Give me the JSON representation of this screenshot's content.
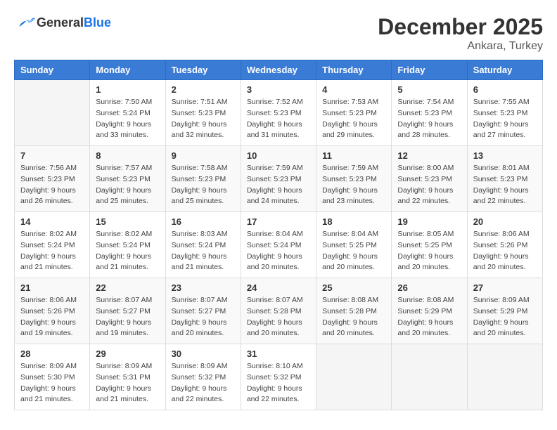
{
  "logo": {
    "general": "General",
    "blue": "Blue"
  },
  "header": {
    "month": "December 2025",
    "location": "Ankara, Turkey"
  },
  "weekdays": [
    "Sunday",
    "Monday",
    "Tuesday",
    "Wednesday",
    "Thursday",
    "Friday",
    "Saturday"
  ],
  "weeks": [
    [
      {
        "day": "",
        "info": ""
      },
      {
        "day": "1",
        "info": "Sunrise: 7:50 AM\nSunset: 5:24 PM\nDaylight: 9 hours\nand 33 minutes."
      },
      {
        "day": "2",
        "info": "Sunrise: 7:51 AM\nSunset: 5:23 PM\nDaylight: 9 hours\nand 32 minutes."
      },
      {
        "day": "3",
        "info": "Sunrise: 7:52 AM\nSunset: 5:23 PM\nDaylight: 9 hours\nand 31 minutes."
      },
      {
        "day": "4",
        "info": "Sunrise: 7:53 AM\nSunset: 5:23 PM\nDaylight: 9 hours\nand 29 minutes."
      },
      {
        "day": "5",
        "info": "Sunrise: 7:54 AM\nSunset: 5:23 PM\nDaylight: 9 hours\nand 28 minutes."
      },
      {
        "day": "6",
        "info": "Sunrise: 7:55 AM\nSunset: 5:23 PM\nDaylight: 9 hours\nand 27 minutes."
      }
    ],
    [
      {
        "day": "7",
        "info": "Sunrise: 7:56 AM\nSunset: 5:23 PM\nDaylight: 9 hours\nand 26 minutes."
      },
      {
        "day": "8",
        "info": "Sunrise: 7:57 AM\nSunset: 5:23 PM\nDaylight: 9 hours\nand 25 minutes."
      },
      {
        "day": "9",
        "info": "Sunrise: 7:58 AM\nSunset: 5:23 PM\nDaylight: 9 hours\nand 25 minutes."
      },
      {
        "day": "10",
        "info": "Sunrise: 7:59 AM\nSunset: 5:23 PM\nDaylight: 9 hours\nand 24 minutes."
      },
      {
        "day": "11",
        "info": "Sunrise: 7:59 AM\nSunset: 5:23 PM\nDaylight: 9 hours\nand 23 minutes."
      },
      {
        "day": "12",
        "info": "Sunrise: 8:00 AM\nSunset: 5:23 PM\nDaylight: 9 hours\nand 22 minutes."
      },
      {
        "day": "13",
        "info": "Sunrise: 8:01 AM\nSunset: 5:23 PM\nDaylight: 9 hours\nand 22 minutes."
      }
    ],
    [
      {
        "day": "14",
        "info": "Sunrise: 8:02 AM\nSunset: 5:24 PM\nDaylight: 9 hours\nand 21 minutes."
      },
      {
        "day": "15",
        "info": "Sunrise: 8:02 AM\nSunset: 5:24 PM\nDaylight: 9 hours\nand 21 minutes."
      },
      {
        "day": "16",
        "info": "Sunrise: 8:03 AM\nSunset: 5:24 PM\nDaylight: 9 hours\nand 21 minutes."
      },
      {
        "day": "17",
        "info": "Sunrise: 8:04 AM\nSunset: 5:24 PM\nDaylight: 9 hours\nand 20 minutes."
      },
      {
        "day": "18",
        "info": "Sunrise: 8:04 AM\nSunset: 5:25 PM\nDaylight: 9 hours\nand 20 minutes."
      },
      {
        "day": "19",
        "info": "Sunrise: 8:05 AM\nSunset: 5:25 PM\nDaylight: 9 hours\nand 20 minutes."
      },
      {
        "day": "20",
        "info": "Sunrise: 8:06 AM\nSunset: 5:26 PM\nDaylight: 9 hours\nand 20 minutes."
      }
    ],
    [
      {
        "day": "21",
        "info": "Sunrise: 8:06 AM\nSunset: 5:26 PM\nDaylight: 9 hours\nand 19 minutes."
      },
      {
        "day": "22",
        "info": "Sunrise: 8:07 AM\nSunset: 5:27 PM\nDaylight: 9 hours\nand 19 minutes."
      },
      {
        "day": "23",
        "info": "Sunrise: 8:07 AM\nSunset: 5:27 PM\nDaylight: 9 hours\nand 20 minutes."
      },
      {
        "day": "24",
        "info": "Sunrise: 8:07 AM\nSunset: 5:28 PM\nDaylight: 9 hours\nand 20 minutes."
      },
      {
        "day": "25",
        "info": "Sunrise: 8:08 AM\nSunset: 5:28 PM\nDaylight: 9 hours\nand 20 minutes."
      },
      {
        "day": "26",
        "info": "Sunrise: 8:08 AM\nSunset: 5:29 PM\nDaylight: 9 hours\nand 20 minutes."
      },
      {
        "day": "27",
        "info": "Sunrise: 8:09 AM\nSunset: 5:29 PM\nDaylight: 9 hours\nand 20 minutes."
      }
    ],
    [
      {
        "day": "28",
        "info": "Sunrise: 8:09 AM\nSunset: 5:30 PM\nDaylight: 9 hours\nand 21 minutes."
      },
      {
        "day": "29",
        "info": "Sunrise: 8:09 AM\nSunset: 5:31 PM\nDaylight: 9 hours\nand 21 minutes."
      },
      {
        "day": "30",
        "info": "Sunrise: 8:09 AM\nSunset: 5:32 PM\nDaylight: 9 hours\nand 22 minutes."
      },
      {
        "day": "31",
        "info": "Sunrise: 8:10 AM\nSunset: 5:32 PM\nDaylight: 9 hours\nand 22 minutes."
      },
      {
        "day": "",
        "info": ""
      },
      {
        "day": "",
        "info": ""
      },
      {
        "day": "",
        "info": ""
      }
    ]
  ]
}
